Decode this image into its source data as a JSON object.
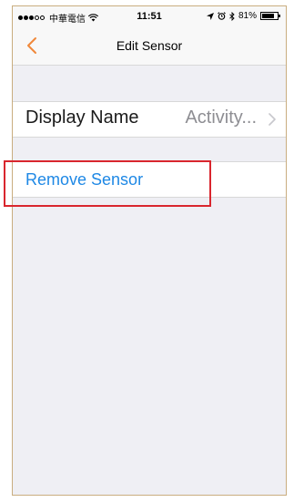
{
  "status_bar": {
    "carrier": "中華電信",
    "time": "11:51",
    "battery": "81%",
    "battery_level": 0.81,
    "icons": [
      "signal-dots-icon",
      "wifi-icon",
      "location-arrow-icon",
      "alarm-icon",
      "bluetooth-icon",
      "battery-icon"
    ]
  },
  "nav": {
    "title": "Edit Sensor",
    "back_icon": "chevron-left-icon",
    "accent_color": "#f0883a"
  },
  "rows": {
    "display_name": {
      "label": "Display Name",
      "value": "Activity...",
      "icon": "chevron-right-icon"
    },
    "remove": {
      "label": "Remove Sensor",
      "color": "#1e88e5"
    }
  },
  "highlight_color": "#d9262e"
}
